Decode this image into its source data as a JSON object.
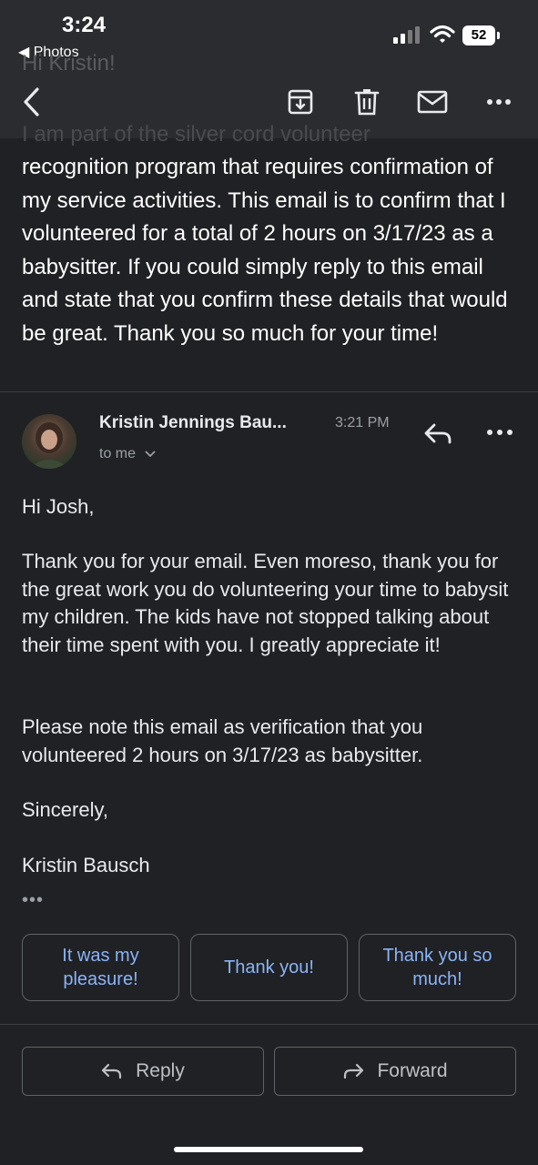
{
  "status_bar": {
    "time": "3:24",
    "back_app": "◀ Photos",
    "battery": "52"
  },
  "ghost": {
    "greeting": "Hi Kristin!",
    "first_line": "I am part of the silver cord volunteer"
  },
  "previous_message": {
    "body": "recognition program that requires confirmation of my service activities. This email is to confirm that I volunteered for a total of 2 hours on 3/17/23 as a babysitter. If you could simply reply to this email and state that you confirm these details that would be great. Thank you so much for your time!"
  },
  "reply_message": {
    "sender": "Kristin Jennings Bau...",
    "time": "3:21 PM",
    "recipient": "to me",
    "greeting": "Hi Josh,",
    "para1": "Thank you for your email.  Even moreso, thank you for the great work you do volunteering your time to babysit my children.  The kids have not stopped talking about their time spent with you.  I greatly appreciate it!",
    "para2": "Please note this email as verification that you volunteered 2 hours on 3/17/23 as babysitter.",
    "closing": "Sincerely,",
    "signature": "Kristin Bausch",
    "trimmed": "•••"
  },
  "smart_replies": [
    "It was my pleasure!",
    "Thank you!",
    "Thank you so much!"
  ],
  "actions": {
    "reply": "Reply",
    "forward": "Forward"
  },
  "colors": {
    "background": "#202124",
    "toolbar": "#2b2c2f",
    "accent": "#8ab4f8"
  },
  "icons": [
    "back-icon",
    "archive-icon",
    "trash-icon",
    "mail-icon",
    "more-icon",
    "reply-icon",
    "forward-icon"
  ]
}
